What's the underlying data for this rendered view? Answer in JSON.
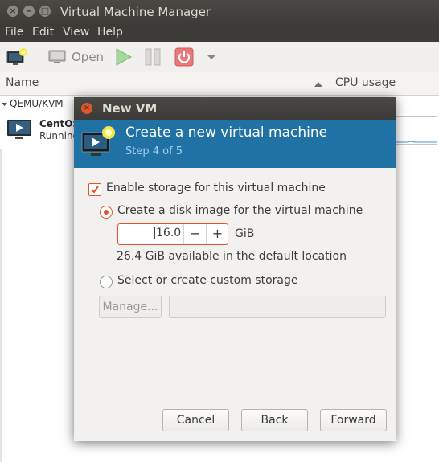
{
  "window": {
    "title": "Virtual Machine Manager"
  },
  "menubar": {
    "items": [
      "File",
      "Edit",
      "View",
      "Help"
    ]
  },
  "toolbar": {
    "open_label": "Open"
  },
  "columns": {
    "name": "Name",
    "cpu": "CPU usage"
  },
  "vm_list": {
    "group": "QEMU/KVM",
    "vm": {
      "name": "CentOS",
      "status": "Running"
    }
  },
  "dialog": {
    "title": "New VM",
    "heading": "Create a new virtual machine",
    "step": "Step 4 of 5",
    "enable_storage": {
      "label": "Enable storage for this virtual machine",
      "checked": true
    },
    "create_disk": {
      "label": "Create a disk image for the virtual machine",
      "selected": true
    },
    "disk_size": {
      "value": "16.0",
      "unit": "GiB",
      "decrement": "−",
      "increment": "+"
    },
    "available_text": "26.4 GiB available in the default location",
    "custom_storage": {
      "label": "Select or create custom storage",
      "selected": false
    },
    "manage_label": "Manage...",
    "storage_path_value": "",
    "buttons": {
      "cancel": "Cancel",
      "back": "Back",
      "forward": "Forward"
    }
  },
  "colors": {
    "accent": "#e0562a",
    "header": "#1f72a3",
    "titlebar": "#3c3b37"
  }
}
